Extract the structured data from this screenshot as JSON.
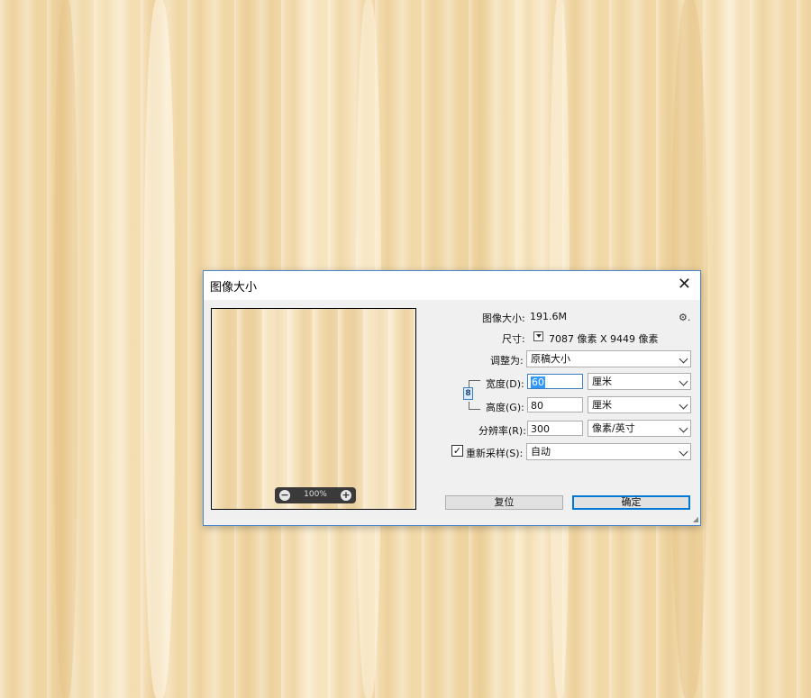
{
  "dialog": {
    "title": "图像大小",
    "close_label": "✕"
  },
  "preview": {
    "zoom_minus": "−",
    "zoom_level": "100%",
    "zoom_plus": "+"
  },
  "info": {
    "image_size_label": "图像大小:",
    "image_size_value": "191.6M",
    "gear_icon": "⚙.",
    "dimensions_label": "尺寸:",
    "dimensions_value": "7087 像素  X  9449 像素"
  },
  "form": {
    "fit_to_label": "调整为:",
    "fit_to_value": "原稿大小",
    "width_label": "宽度(D):",
    "width_value": "60",
    "width_unit": "厘米",
    "height_label": "高度(G):",
    "height_value": "80",
    "height_unit": "厘米",
    "resolution_label": "分辨率(R):",
    "resolution_value": "300",
    "resolution_unit": "像素/英寸",
    "resample_checked_mark": "✓",
    "resample_label": "重新采样(S):",
    "resample_value": "自动",
    "link_icon_glyph": "8"
  },
  "buttons": {
    "reset_label": "复位",
    "ok_label": "确定"
  }
}
